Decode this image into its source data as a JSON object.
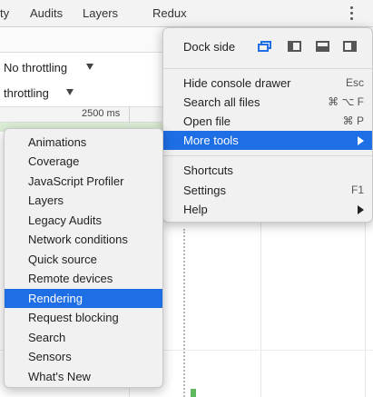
{
  "tabs": [
    {
      "label": "ty"
    },
    {
      "label": "Audits"
    },
    {
      "label": "Layers"
    },
    {
      "label": "Redux"
    }
  ],
  "throttling": {
    "network": "No throttling",
    "cpu": "throttling"
  },
  "timeline": {
    "ruler_label": "2500 ms"
  },
  "menu": {
    "dock_side_label": "Dock side",
    "dock_options": [
      "undock",
      "dock-left",
      "dock-bottom",
      "dock-right"
    ],
    "items": [
      {
        "label": "Hide console drawer",
        "shortcut": "Esc"
      },
      {
        "label": "Search all files",
        "shortcut": "⌘ ⌥ F"
      },
      {
        "label": "Open file",
        "shortcut": "⌘ P"
      },
      {
        "label": "More tools",
        "shortcut": "",
        "submenu": true,
        "active": true
      },
      {
        "label": "Shortcuts",
        "shortcut": ""
      },
      {
        "label": "Settings",
        "shortcut": "F1"
      },
      {
        "label": "Help",
        "shortcut": "",
        "submenu": true
      }
    ]
  },
  "submenu": {
    "items": [
      "Animations",
      "Coverage",
      "JavaScript Profiler",
      "Layers",
      "Legacy Audits",
      "Network conditions",
      "Quick source",
      "Remote devices",
      "Rendering",
      "Request blocking",
      "Search",
      "Sensors",
      "What's New"
    ],
    "active": "Rendering"
  },
  "colors": {
    "accent": "#1e6fe6",
    "track": "#dcefd6",
    "marker": "#5fb95f"
  }
}
